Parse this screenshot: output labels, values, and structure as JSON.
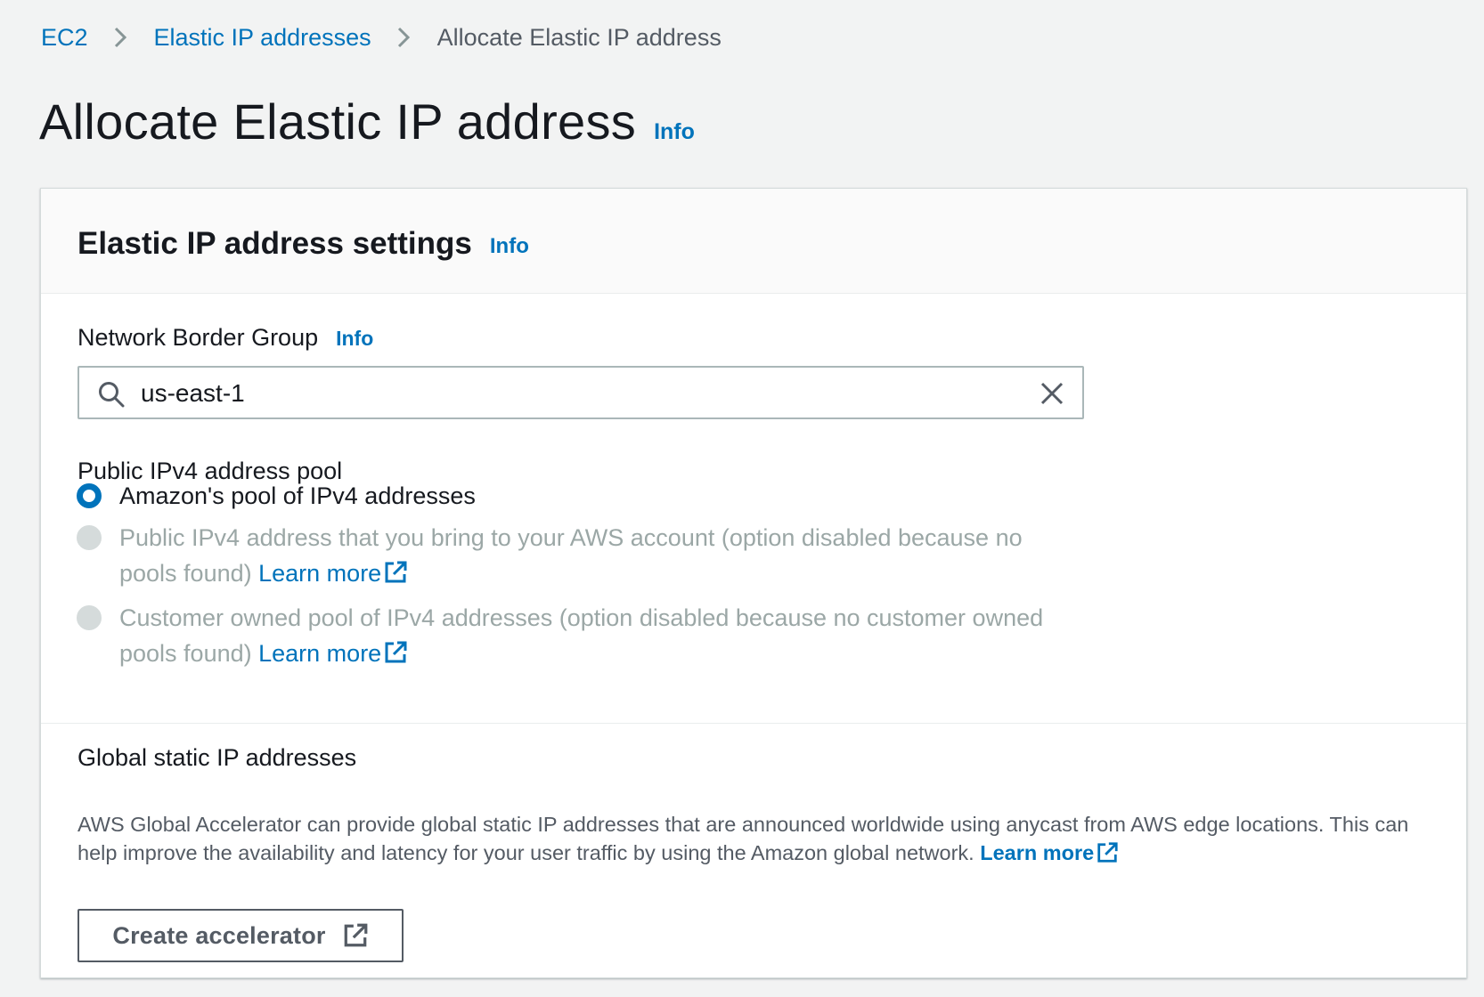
{
  "breadcrumb": {
    "items": [
      {
        "label": "EC2"
      },
      {
        "label": "Elastic IP addresses"
      },
      {
        "label": "Allocate Elastic IP address"
      }
    ]
  },
  "page": {
    "title": "Allocate Elastic IP address",
    "info_label": "Info"
  },
  "panel": {
    "title": "Elastic IP address settings",
    "info_label": "Info",
    "network_border_group": {
      "label": "Network Border Group",
      "info_label": "Info",
      "value": "us-east-1"
    },
    "pool": {
      "label": "Public IPv4 address pool",
      "options": [
        {
          "text": "Amazon's pool of IPv4 addresses",
          "selected": true,
          "disabled": false
        },
        {
          "text": "Public IPv4 address that you bring to your AWS account (option disabled because no pools found)",
          "selected": false,
          "disabled": true,
          "link": "Learn more"
        },
        {
          "text": "Customer owned pool of IPv4 addresses (option disabled because no customer owned pools found)",
          "selected": false,
          "disabled": true,
          "link": "Learn more"
        }
      ]
    },
    "global": {
      "title": "Global static IP addresses",
      "description": "AWS Global Accelerator can provide global static IP addresses that are announced worldwide using anycast from AWS edge locations. This can help improve the availability and latency for your user traffic by using the Amazon global network.",
      "link": "Learn more",
      "button_label": "Create accelerator"
    }
  },
  "colors": {
    "link": "#0073bb",
    "background": "#f2f3f3",
    "disabled_text": "#9ba7a6"
  },
  "icons": {
    "breadcrumb_separator": "chevron-right-icon",
    "search": "search-icon",
    "clear": "close-icon",
    "external_link": "external-link-icon"
  }
}
